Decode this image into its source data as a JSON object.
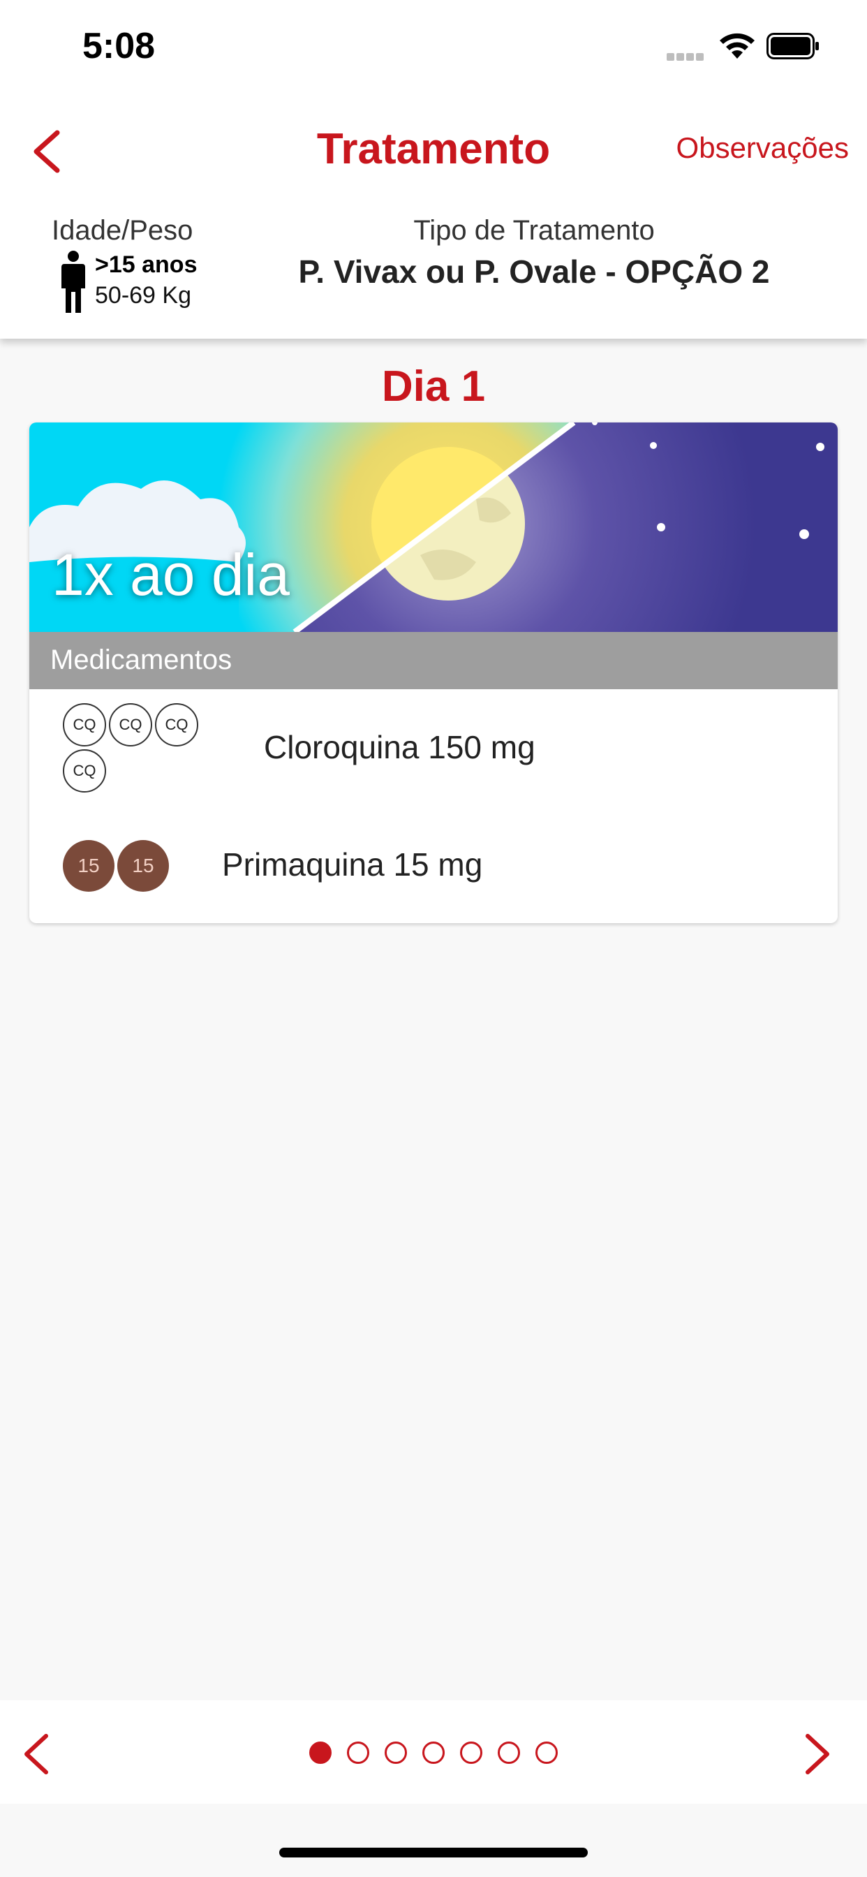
{
  "status_bar": {
    "time": "5:08"
  },
  "nav": {
    "title": "Tratamento",
    "observations_label": "Observações"
  },
  "patient": {
    "age_weight_label": "Idade/Peso",
    "age": ">15 anos",
    "weight": "50-69 Kg",
    "treatment_type_label": "Tipo de Tratamento",
    "treatment_type": "P. Vivax ou P. Ovale - OPÇÃO 2"
  },
  "day": {
    "title": "Dia 1"
  },
  "card": {
    "frequency": "1x ao dia",
    "medications_header": "Medicamentos",
    "medications": [
      {
        "name": "Cloroquina 150 mg",
        "pill_label": "CQ",
        "pill_count": 4
      },
      {
        "name": "Primaquina 15 mg",
        "pill_label": "15",
        "pill_count": 2
      }
    ]
  },
  "pager": {
    "total_pages": 7,
    "current_page": 1
  },
  "colors": {
    "accent": "#c8161d",
    "primaquine_pill": "#7b4a3a",
    "header_gray": "#9e9e9e"
  },
  "icons": [
    "chevron-left-icon",
    "chevron-right-icon",
    "person-icon",
    "wifi-icon",
    "battery-icon",
    "signal-icon"
  ]
}
